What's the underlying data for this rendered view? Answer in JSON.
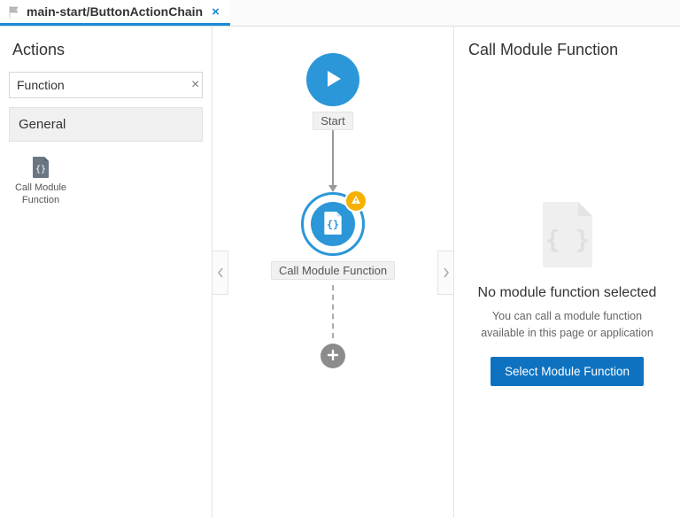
{
  "tab": {
    "label": "main-start/ButtonActionChain"
  },
  "left": {
    "title": "Actions",
    "search_value": "Function",
    "group_label": "General",
    "palette": [
      {
        "label": "Call Module Function"
      }
    ]
  },
  "canvas": {
    "start_label": "Start",
    "module_label": "Call Module Function"
  },
  "right": {
    "title": "Call Module Function",
    "empty_title": "No module function selected",
    "empty_desc": "You can call a module function available in this page or application",
    "select_btn": "Select Module Function"
  }
}
